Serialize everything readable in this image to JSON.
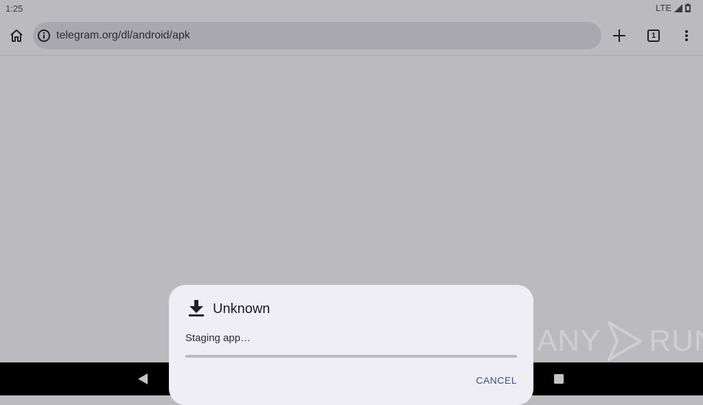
{
  "status_bar": {
    "time": "1:25",
    "network": "LTE"
  },
  "browser": {
    "url": "telegram.org/dl/android/apk",
    "tab_count": "1",
    "icons": {
      "home": "home-icon",
      "info": "info-icon",
      "new_tab": "plus-icon",
      "tabs": "tab-switcher-icon",
      "menu": "more-vert-icon"
    }
  },
  "dialog": {
    "title": "Unknown",
    "message": "Staging app…",
    "progress": 0,
    "cancel_label": "CANCEL",
    "icon": "download-icon"
  },
  "watermark": {
    "left": "ANY",
    "right": "RUN"
  },
  "nav_bar": {
    "back": "back-icon",
    "home": "home-dot-icon",
    "recents": "recents-icon"
  }
}
